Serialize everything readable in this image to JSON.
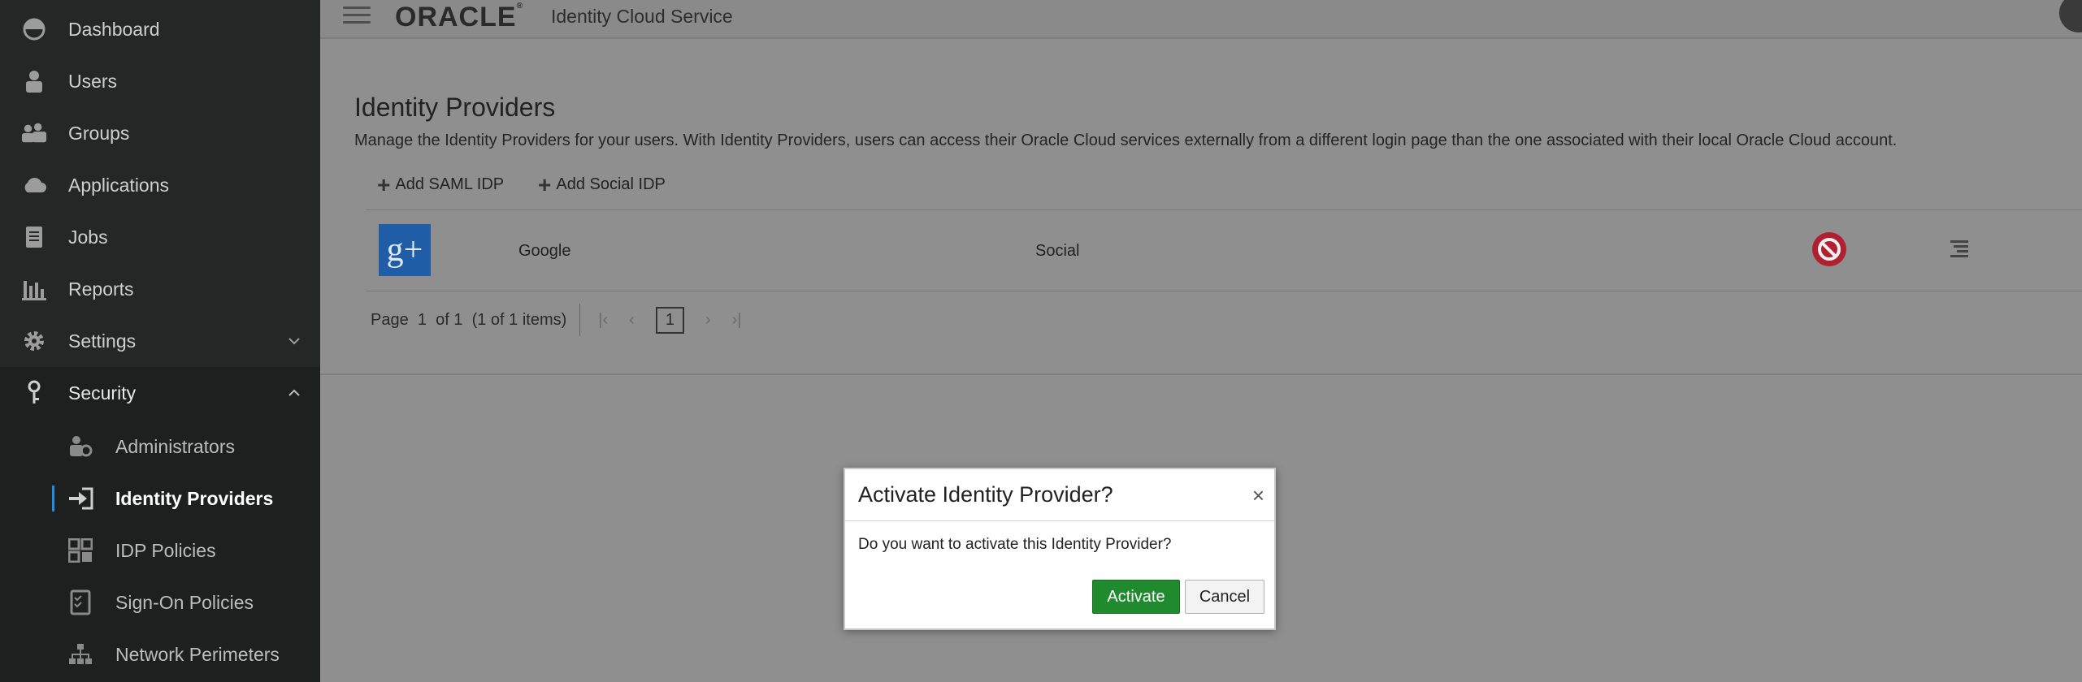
{
  "sidebar": {
    "items": [
      {
        "label": "Dashboard",
        "icon": "dashboard-icon"
      },
      {
        "label": "Users",
        "icon": "user-icon"
      },
      {
        "label": "Groups",
        "icon": "groups-icon"
      },
      {
        "label": "Applications",
        "icon": "cloud-icon"
      },
      {
        "label": "Jobs",
        "icon": "jobs-icon"
      },
      {
        "label": "Reports",
        "icon": "bar-chart-icon"
      },
      {
        "label": "Settings",
        "icon": "gear-icon"
      },
      {
        "label": "Security",
        "icon": "key-icon"
      }
    ],
    "security_sub": [
      {
        "label": "Administrators",
        "icon": "admin-icon"
      },
      {
        "label": "Identity Providers",
        "icon": "sign-in-icon"
      },
      {
        "label": "IDP Policies",
        "icon": "idp-policy-icon"
      },
      {
        "label": "Sign-On Policies",
        "icon": "checklist-icon"
      },
      {
        "label": "Network Perimeters",
        "icon": "network-icon"
      }
    ]
  },
  "header": {
    "logo": "ORACLE",
    "logo_mark": "®",
    "product": "Identity Cloud Service"
  },
  "main": {
    "title": "Identity Providers",
    "description": "Manage the Identity Providers for your users. With Identity Providers, users can access their Oracle Cloud services externally from a different login page than the one associated with their local Oracle Cloud account.",
    "toolbar": {
      "add_saml": "Add SAML IDP",
      "add_social": "Add Social IDP"
    },
    "rows": [
      {
        "name": "Google",
        "type": "Social",
        "logo": "g+"
      }
    ],
    "pager": {
      "page_label": "Page",
      "page": "1",
      "of_label": "of 1",
      "items": "(1 of 1 items)",
      "current": "1"
    }
  },
  "dialog": {
    "title": "Activate Identity Provider?",
    "close": "×",
    "message": "Do you want to activate this Identity Provider?",
    "activate": "Activate",
    "cancel": "Cancel"
  },
  "colors": {
    "sidebar_bg": "#252626",
    "active_accent": "#1f8ee0",
    "activate_btn": "#1f8a2e",
    "deactivate_icon": "#b02030",
    "google_blue": "#1f5ea6"
  }
}
